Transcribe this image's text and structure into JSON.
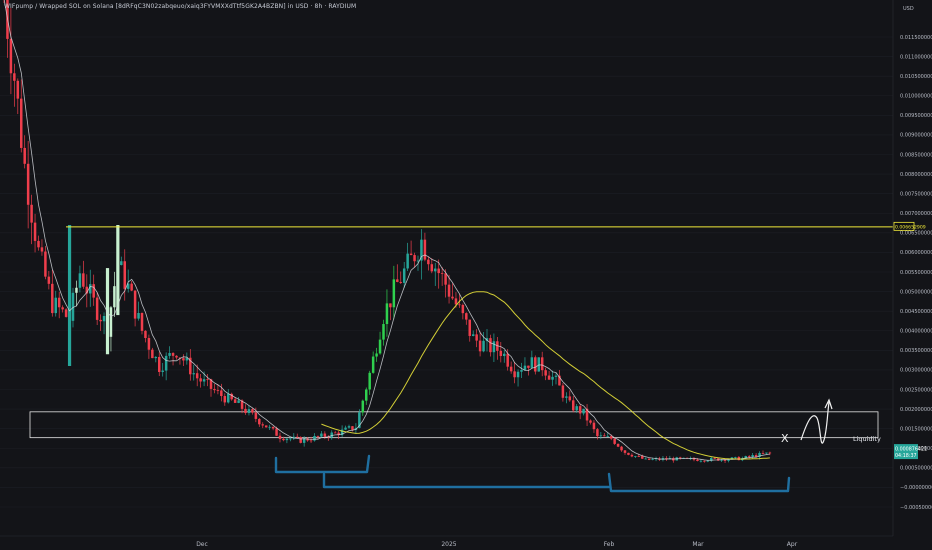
{
  "header": {
    "title": "WIFpump / Wrapped SOL on Solana [8dRFqC3N02zabqeuo/xaiq3FYVMXXdTtf5GK2A4BZBN] in USD · 8h · RAYDIUM"
  },
  "price_axis": {
    "currency": "USD",
    "ticks": [
      "0.011500000",
      "0.011000000",
      "0.010500000",
      "0.010000000",
      "0.009500000",
      "0.009000000",
      "0.008500000",
      "0.008000000",
      "0.007500000",
      "0.007000000",
      "0.006500000",
      "0.006000000",
      "0.005500000",
      "0.005000000",
      "0.004500000",
      "0.004000000",
      "0.003500000",
      "0.003000000",
      "0.002500000",
      "0.002000000",
      "0.001500000",
      "0.001000000",
      "0.000500000",
      "−0.000000000",
      "−0.000500000"
    ],
    "level_label": "0.006652909",
    "current_price_label": "0.000876421",
    "countdown_label": "04:18:37"
  },
  "time_axis": {
    "ticks": [
      "Dec",
      "2025",
      "Feb",
      "Mar",
      "Apr"
    ]
  },
  "annotations": {
    "liquidity_label": "Liquidity",
    "x_mark": "X"
  },
  "colors": {
    "up": "#26a69a",
    "up_bright": "#2fd14f",
    "up_pale": "#c8f0d0",
    "down": "#ef3e4c",
    "ma_fast": "#d6d8de",
    "ma_slow": "#e8e23a",
    "level": "#f2ea3a",
    "bracket": "#1f6fa0",
    "box": "#e6e6e6",
    "price_badge": "#26a69a"
  },
  "chart_data": {
    "type": "candlestick",
    "title": "WIFpump / Wrapped SOL on Solana [8dRFqC3N02zabqeuo/xaiq3FYVMXXdTtf5GK2A4BZBN] in USD · 8h · RAYDIUM",
    "y_unit": "USD",
    "ylim": [
      -0.0006,
      0.0118
    ],
    "x_ticks": [
      "Dec",
      "2025",
      "Feb",
      "Mar",
      "Apr"
    ],
    "horizontal_level": 0.006652909,
    "current_price": 0.000876421,
    "liquidity_zone": [
      0.00127,
      0.00193
    ],
    "anchors": [
      [
        0,
        0.0125
      ],
      [
        3,
        0.0105
      ],
      [
        6,
        0.0082
      ],
      [
        10,
        0.006
      ],
      [
        14,
        0.0047
      ],
      [
        19,
        0.0043
      ],
      [
        22,
        0.0055
      ],
      [
        26,
        0.0047
      ],
      [
        30,
        0.0041
      ],
      [
        33,
        0.0057
      ],
      [
        36,
        0.0051
      ],
      [
        40,
        0.004
      ],
      [
        45,
        0.0031
      ],
      [
        50,
        0.0035
      ],
      [
        56,
        0.0028
      ],
      [
        62,
        0.0024
      ],
      [
        68,
        0.0021
      ],
      [
        74,
        0.0017
      ],
      [
        80,
        0.0013
      ],
      [
        86,
        0.0012
      ],
      [
        92,
        0.0013
      ],
      [
        97,
        0.0014
      ],
      [
        102,
        0.00155
      ],
      [
        106,
        0.0029
      ],
      [
        110,
        0.0044
      ],
      [
        114,
        0.0052
      ],
      [
        118,
        0.0058
      ],
      [
        121,
        0.0063
      ],
      [
        124,
        0.0058
      ],
      [
        128,
        0.0052
      ],
      [
        132,
        0.0045
      ],
      [
        136,
        0.0038
      ],
      [
        140,
        0.0036
      ],
      [
        144,
        0.0035
      ],
      [
        148,
        0.003
      ],
      [
        152,
        0.0032
      ],
      [
        156,
        0.0031
      ],
      [
        160,
        0.0027
      ],
      [
        164,
        0.0021
      ],
      [
        168,
        0.0019
      ],
      [
        172,
        0.0013
      ],
      [
        176,
        0.00125
      ],
      [
        180,
        0.0009
      ],
      [
        186,
        0.0007
      ],
      [
        192,
        0.00073
      ],
      [
        200,
        0.00071
      ],
      [
        208,
        0.00072
      ],
      [
        214,
        0.00074
      ],
      [
        218,
        0.00082
      ],
      [
        222,
        0.000876
      ]
    ]
  }
}
